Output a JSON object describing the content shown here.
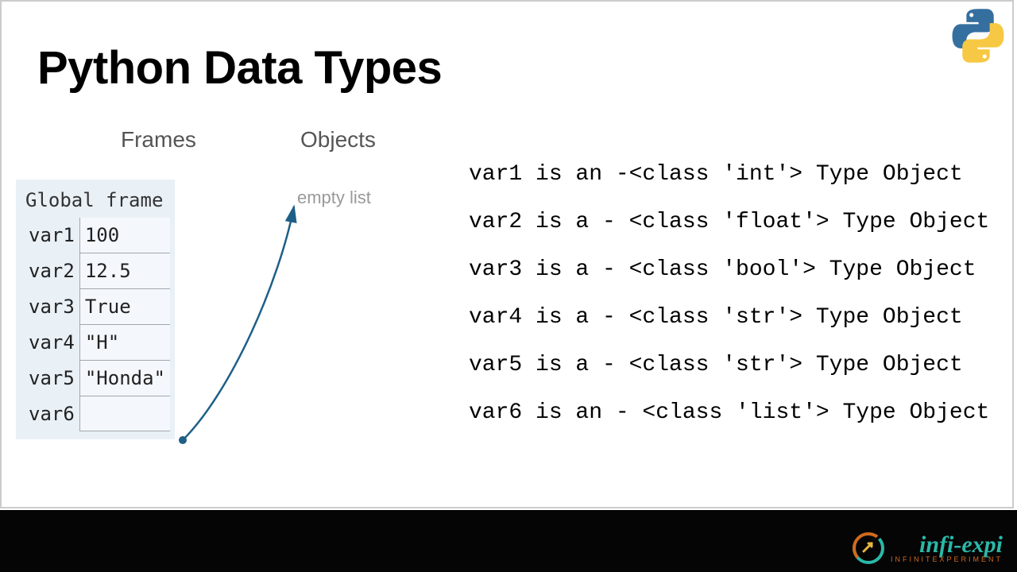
{
  "title": "Python Data Types",
  "columns": {
    "frames": "Frames",
    "objects": "Objects"
  },
  "frame": {
    "label": "Global frame",
    "rows": [
      {
        "name": "var1",
        "value": "100"
      },
      {
        "name": "var2",
        "value": "12.5"
      },
      {
        "name": "var3",
        "value": "True"
      },
      {
        "name": "var4",
        "value": "\"H\""
      },
      {
        "name": "var5",
        "value": "\"Honda\""
      },
      {
        "name": "var6",
        "value": ""
      }
    ]
  },
  "object_label": "empty list",
  "output": [
    "var1 is an -<class 'int'> Type Object",
    "var2 is a - <class 'float'> Type Object",
    "var3 is a - <class 'bool'> Type Object",
    "var4 is a - <class 'str'> Type Object",
    "var5 is a - <class 'str'> Type Object",
    "var6 is an - <class 'list'> Type Object"
  ],
  "branding": {
    "name": "infi-expi",
    "tagline": "INFINITEXPERIMENT"
  }
}
